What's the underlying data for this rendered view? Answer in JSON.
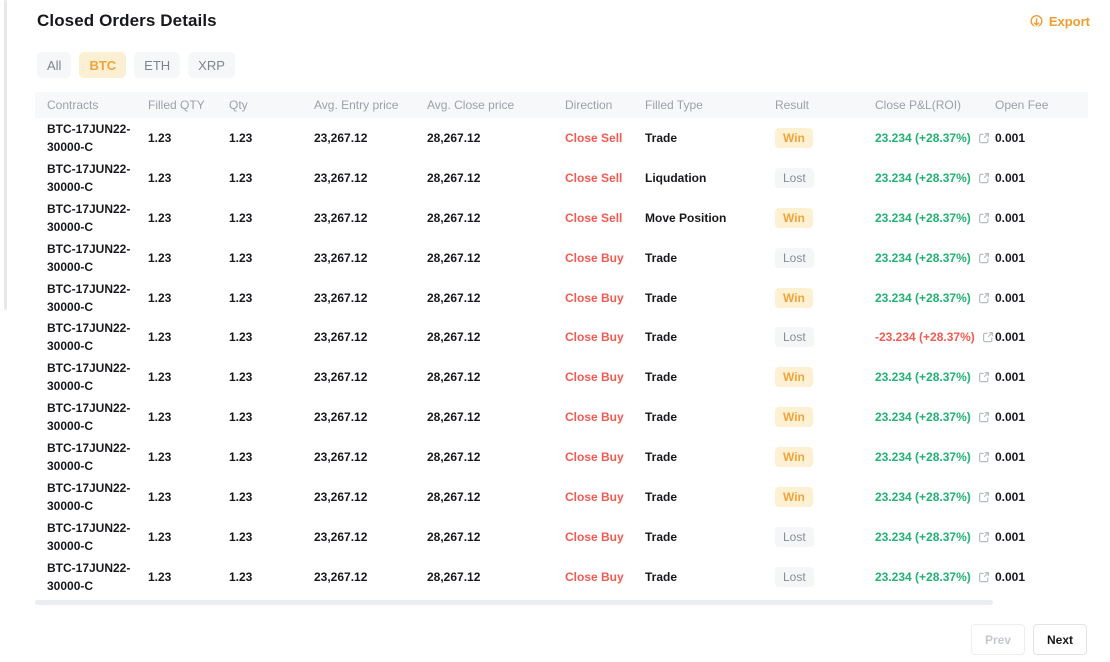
{
  "header": {
    "title": "Closed Orders Details",
    "export_label": "Export"
  },
  "tabs": [
    {
      "label": "All",
      "active": false
    },
    {
      "label": "BTC",
      "active": true
    },
    {
      "label": "ETH",
      "active": false
    },
    {
      "label": "XRP",
      "active": false
    }
  ],
  "table": {
    "columns": [
      "Contracts",
      "Filled QTY",
      "Qty",
      "Avg. Entry price",
      "Avg. Close price",
      "Direction",
      "Filled Type",
      "Result",
      "Close P&L(ROI)",
      "Open Fee"
    ],
    "rows": [
      {
        "contracts": "BTC-17JUN22-30000-C",
        "filled_qty": "1.23",
        "qty": "1.23",
        "avg_entry_price": "23,267.12",
        "avg_close_price": "28,267.12",
        "direction": "Close Sell",
        "filled_type": "Trade",
        "result": "Win",
        "close_pnl_roi": "23.234 (+28.37%)",
        "open_fee": "0.001"
      },
      {
        "contracts": "BTC-17JUN22-30000-C",
        "filled_qty": "1.23",
        "qty": "1.23",
        "avg_entry_price": "23,267.12",
        "avg_close_price": "28,267.12",
        "direction": "Close Sell",
        "filled_type": "Liqudation",
        "result": "Lost",
        "close_pnl_roi": "23.234 (+28.37%)",
        "open_fee": "0.001"
      },
      {
        "contracts": "BTC-17JUN22-30000-C",
        "filled_qty": "1.23",
        "qty": "1.23",
        "avg_entry_price": "23,267.12",
        "avg_close_price": "28,267.12",
        "direction": "Close Sell",
        "filled_type": "Move Position",
        "result": "Win",
        "close_pnl_roi": "23.234 (+28.37%)",
        "open_fee": "0.001"
      },
      {
        "contracts": "BTC-17JUN22-30000-C",
        "filled_qty": "1.23",
        "qty": "1.23",
        "avg_entry_price": "23,267.12",
        "avg_close_price": "28,267.12",
        "direction": "Close Buy",
        "filled_type": "Trade",
        "result": "Lost",
        "close_pnl_roi": "23.234 (+28.37%)",
        "open_fee": "0.001"
      },
      {
        "contracts": "BTC-17JUN22-30000-C",
        "filled_qty": "1.23",
        "qty": "1.23",
        "avg_entry_price": "23,267.12",
        "avg_close_price": "28,267.12",
        "direction": "Close Buy",
        "filled_type": "Trade",
        "result": "Win",
        "close_pnl_roi": "23.234 (+28.37%)",
        "open_fee": "0.001"
      },
      {
        "contracts": "BTC-17JUN22-30000-C",
        "filled_qty": "1.23",
        "qty": "1.23",
        "avg_entry_price": "23,267.12",
        "avg_close_price": "28,267.12",
        "direction": "Close Buy",
        "filled_type": "Trade",
        "result": "Lost",
        "close_pnl_roi": "-23.234 (+28.37%)",
        "open_fee": "0.001"
      },
      {
        "contracts": "BTC-17JUN22-30000-C",
        "filled_qty": "1.23",
        "qty": "1.23",
        "avg_entry_price": "23,267.12",
        "avg_close_price": "28,267.12",
        "direction": "Close Buy",
        "filled_type": "Trade",
        "result": "Win",
        "close_pnl_roi": "23.234 (+28.37%)",
        "open_fee": "0.001"
      },
      {
        "contracts": "BTC-17JUN22-30000-C",
        "filled_qty": "1.23",
        "qty": "1.23",
        "avg_entry_price": "23,267.12",
        "avg_close_price": "28,267.12",
        "direction": "Close Buy",
        "filled_type": "Trade",
        "result": "Win",
        "close_pnl_roi": "23.234 (+28.37%)",
        "open_fee": "0.001"
      },
      {
        "contracts": "BTC-17JUN22-30000-C",
        "filled_qty": "1.23",
        "qty": "1.23",
        "avg_entry_price": "23,267.12",
        "avg_close_price": "28,267.12",
        "direction": "Close Buy",
        "filled_type": "Trade",
        "result": "Win",
        "close_pnl_roi": "23.234 (+28.37%)",
        "open_fee": "0.001"
      },
      {
        "contracts": "BTC-17JUN22-30000-C",
        "filled_qty": "1.23",
        "qty": "1.23",
        "avg_entry_price": "23,267.12",
        "avg_close_price": "28,267.12",
        "direction": "Close Buy",
        "filled_type": "Trade",
        "result": "Win",
        "close_pnl_roi": "23.234 (+28.37%)",
        "open_fee": "0.001"
      },
      {
        "contracts": "BTC-17JUN22-30000-C",
        "filled_qty": "1.23",
        "qty": "1.23",
        "avg_entry_price": "23,267.12",
        "avg_close_price": "28,267.12",
        "direction": "Close Buy",
        "filled_type": "Trade",
        "result": "Lost",
        "close_pnl_roi": "23.234 (+28.37%)",
        "open_fee": "0.001"
      },
      {
        "contracts": "BTC-17JUN22-30000-C",
        "filled_qty": "1.23",
        "qty": "1.23",
        "avg_entry_price": "23,267.12",
        "avg_close_price": "28,267.12",
        "direction": "Close Buy",
        "filled_type": "Trade",
        "result": "Lost",
        "close_pnl_roi": "23.234 (+28.37%)",
        "open_fee": "0.001"
      }
    ]
  },
  "pagination": {
    "prev_label": "Prev",
    "next_label": "Next"
  },
  "colors": {
    "accent_orange": "#ef9e2e",
    "active_tab_bg": "#fcf0d4",
    "active_tab_text": "#f0a43c",
    "direction_red": "#f15b51",
    "profit_green": "#21b373",
    "loss_red": "#f15b51",
    "win_badge_bg": "#fdf0d3",
    "win_badge_text": "#f0a43c",
    "lost_badge_bg": "#f5f6f8",
    "lost_badge_text": "#888d95",
    "table_header_bg": "#f7f8fa"
  }
}
